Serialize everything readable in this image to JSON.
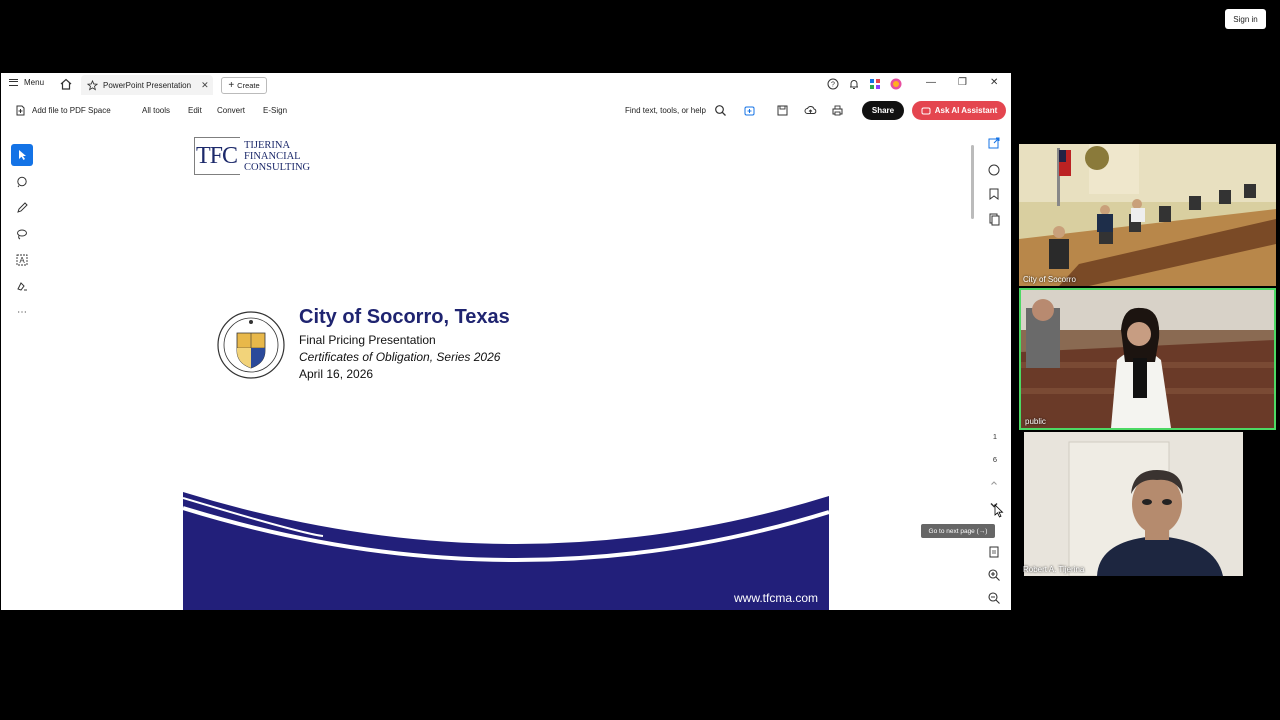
{
  "zoom": {
    "sign_in": "Sign in"
  },
  "window": {
    "menu_label": "Menu",
    "tab_title": "PowerPoint Presentation",
    "tab_close": "✕",
    "create_label": "Create",
    "minimize": "—",
    "restore": "❐",
    "close": "✕"
  },
  "toolbar": {
    "add_file": "Add file to PDF Space",
    "all_tools": "All tools",
    "edit": "Edit",
    "convert": "Convert",
    "esign": "E-Sign",
    "search": "Find text, tools, or help",
    "share": "Share",
    "ai_assistant": "Ask AI Assistant"
  },
  "page_nav": {
    "current_page": "1",
    "total_pages": "6",
    "tooltip": "Go to next page (→)"
  },
  "slide": {
    "logo_letters": "TFC",
    "logo_line1": "TIJERINA",
    "logo_line2": "FINANCIAL",
    "logo_line3": "CONSULTING",
    "title": "City of Socorro, Texas",
    "subtitle": "Final Pricing Presentation",
    "series": "Certificates of Obligation, Series 2026",
    "date": "April 16, 2026",
    "url": "www.tfcma.com",
    "colors": {
      "navy": "#221f7a",
      "title": "#1f2470"
    }
  },
  "participants": [
    {
      "name": "City of Socorro"
    },
    {
      "name": "public"
    },
    {
      "name": "Robert A. Tijerina"
    }
  ],
  "colors": {
    "active_speaker_border": "#4cd964",
    "ai_button": "#e4454f",
    "share_button": "#111111"
  }
}
